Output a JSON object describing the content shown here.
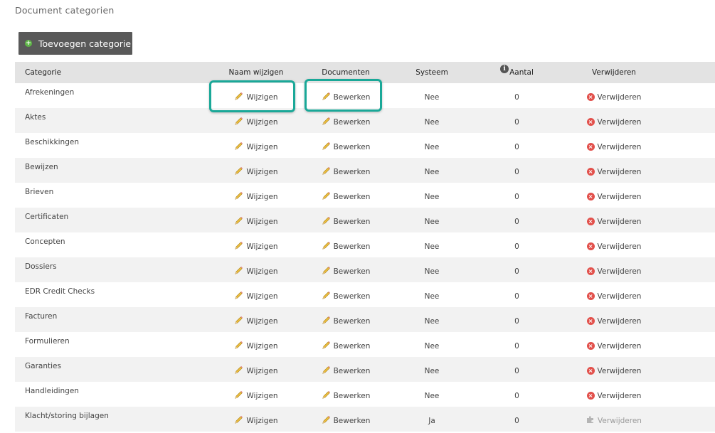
{
  "page": {
    "title": "Document categorien"
  },
  "toolbar": {
    "add_label": "Toevoegen categorie"
  },
  "table": {
    "headers": {
      "categorie": "Categorie",
      "naam": "Naam wijzigen",
      "documenten": "Documenten",
      "systeem": "Systeem",
      "aantal": "Aantal",
      "verwijderen": "Verwijderen"
    },
    "rows": [
      {
        "categorie": "Afrekeningen",
        "naam": "Wijzigen",
        "documenten": "Bewerken",
        "systeem": "Nee",
        "aantal": "0",
        "verwijderen": "Verwijderen"
      },
      {
        "categorie": "Aktes",
        "naam": "Wijzigen",
        "documenten": "Bewerken",
        "systeem": "Nee",
        "aantal": "0",
        "verwijderen": "Verwijderen"
      },
      {
        "categorie": "Beschikkingen",
        "naam": "Wijzigen",
        "documenten": "Bewerken",
        "systeem": "Nee",
        "aantal": "0",
        "verwijderen": "Verwijderen"
      },
      {
        "categorie": "Bewijzen",
        "naam": "Wijzigen",
        "documenten": "Bewerken",
        "systeem": "Nee",
        "aantal": "0",
        "verwijderen": "Verwijderen"
      },
      {
        "categorie": "Brieven",
        "naam": "Wijzigen",
        "documenten": "Bewerken",
        "systeem": "Nee",
        "aantal": "0",
        "verwijderen": "Verwijderen"
      },
      {
        "categorie": "Certificaten",
        "naam": "Wijzigen",
        "documenten": "Bewerken",
        "systeem": "Nee",
        "aantal": "0",
        "verwijderen": "Verwijderen"
      },
      {
        "categorie": "Concepten",
        "naam": "Wijzigen",
        "documenten": "Bewerken",
        "systeem": "Nee",
        "aantal": "0",
        "verwijderen": "Verwijderen"
      },
      {
        "categorie": "Dossiers",
        "naam": "Wijzigen",
        "documenten": "Bewerken",
        "systeem": "Nee",
        "aantal": "0",
        "verwijderen": "Verwijderen"
      },
      {
        "categorie": "EDR Credit Checks",
        "naam": "Wijzigen",
        "documenten": "Bewerken",
        "systeem": "Nee",
        "aantal": "0",
        "verwijderen": "Verwijderen"
      },
      {
        "categorie": "Facturen",
        "naam": "Wijzigen",
        "documenten": "Bewerken",
        "systeem": "Nee",
        "aantal": "0",
        "verwijderen": "Verwijderen"
      },
      {
        "categorie": "Formulieren",
        "naam": "Wijzigen",
        "documenten": "Bewerken",
        "systeem": "Nee",
        "aantal": "0",
        "verwijderen": "Verwijderen"
      },
      {
        "categorie": "Garanties",
        "naam": "Wijzigen",
        "documenten": "Bewerken",
        "systeem": "Nee",
        "aantal": "0",
        "verwijderen": "Verwijderen"
      },
      {
        "categorie": "Handleidingen",
        "naam": "Wijzigen",
        "documenten": "Bewerken",
        "systeem": "Nee",
        "aantal": "0",
        "verwijderen": "Verwijderen"
      },
      {
        "categorie": "Klacht/storing bijlagen",
        "naam": "Wijzigen",
        "documenten": "Bewerken",
        "systeem": "Ja",
        "aantal": "0",
        "verwijderen": "Verwijderen",
        "verwijderen_disabled": true
      }
    ]
  },
  "colors": {
    "highlight": "#1aa898",
    "delete_icon": "#e2504b",
    "add_icon": "#5fb548",
    "button_bg": "#595959"
  },
  "icons": {
    "add": "plus-circle-icon",
    "edit": "pencil-icon",
    "delete": "x-circle-icon",
    "delete_disabled": "puzzle-icon",
    "info": "info-icon"
  }
}
